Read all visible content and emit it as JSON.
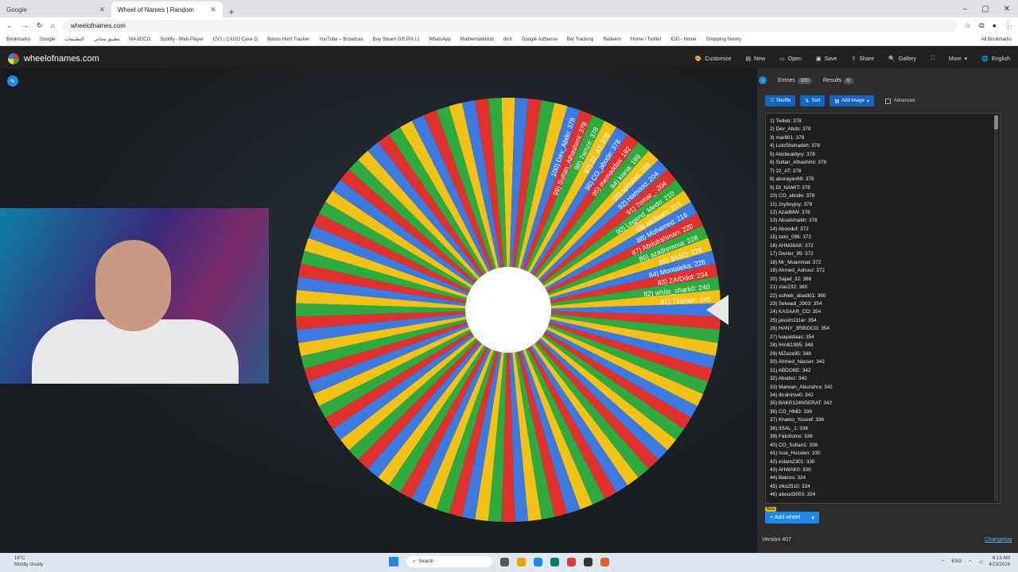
{
  "browser": {
    "tabs": [
      {
        "label": "Google",
        "active": false
      },
      {
        "label": "Wheel of Names | Random",
        "active": true
      }
    ],
    "new_tab": "+",
    "url": "wheelofnames.com",
    "bookmarks": [
      "Bookmarks",
      "Google",
      "التطبيقات",
      "تطبيق مجاني",
      "MAJIDCO",
      "Spotify - Web Player",
      "CV2 | CXGO Case O",
      "Bonus Hunt Tracker",
      "YouTube – Broadcas",
      "Buy Steam Gift PIX Lt",
      "WhatsApp",
      "Mathematikklub",
      "dich",
      "Google AdSense",
      "Bet Tracking",
      "Redeem",
      "Home / Twitter",
      "IOD - Home",
      "Shopping history"
    ],
    "all_bookmarks": "All Bookmarks"
  },
  "app": {
    "site_name": "wheelofnames.com",
    "menu": [
      "Customize",
      "New",
      "Open",
      "Save",
      "Share",
      "Gallery",
      "More",
      "English"
    ]
  },
  "panel": {
    "tab_entries": "Entries",
    "entries_count": "100",
    "tab_results": "Results",
    "results_count": "0",
    "shuffle": "Shuffle",
    "sort": "Sort",
    "add_image": "Add image",
    "advanced": "Advanced",
    "entries": [
      "1) Twileb: 378",
      "2) Dev_Abdo: 378",
      "3) mar801: 378",
      "4) LoloShehadeh: 378",
      "5) Abobealdyry: 378",
      "6) Sultan_Alhashimi: 378",
      "7) 22_AT: 378",
      "8) aburayan69: 378",
      "9) DI_NAMIT: 378",
      "10) CO_abode: 378",
      "11) Joyboyjoy: 378",
      "12) AzadMW: 378",
      "13) Abualshaikh: 378",
      "14) Abooduf: 372",
      "15) zero_096: 372",
      "16) AHM26AK: 372",
      "17) Dexter_95: 372",
      "18) Mr_Muammal: 372",
      "19) Ahmed_Ashour: 372",
      "20) Sajad_32: 366",
      "21) zias232: 360",
      "22) sohieb_abadi01: 360",
      "23) Selwadi_2003: 354",
      "24) KASAAR_CO: 354",
      "25) jassim111er: 354",
      "26) HANY_3RBIDCO: 354",
      "27) luayaldaas: 354",
      "28) IHAB1995: 348",
      "29) MZaza95: 348",
      "30) Ahmed_Nasser: 342",
      "31) ABDOBE: 342",
      "32) Abodez: 342",
      "33) Marwan_Abuzahra: 342",
      "34) Ibrahimw0: 342",
      "35) BAKR124NSERAT: 342",
      "36) CO_HMD: 336",
      "37) Khaloo_Yousef: 336",
      "38) 3SAL_1: 336",
      "39) Fato0omx: 336",
      "40) CO_Sultan1: 336",
      "41) Issa_Hussien: 330",
      "42) eslam2301: 330",
      "43) AHWAK0: 330",
      "44) Bakres: 324",
      "45) ziko2510: 324",
      "46) aboud3003: 324"
    ],
    "beta": "Beta",
    "add_wheel": "Add wheel",
    "version": "Version 407",
    "changelog": "Changelog"
  },
  "wheel": {
    "colors": [
      "#3d7ae0",
      "#e0312f",
      "#2faa3f",
      "#f2c218"
    ],
    "segment_count": 100,
    "visible_labels": [
      "81) 7asnain: 245",
      "82) white_shark0: 240",
      "83) ZAIDdol: 234",
      "84) Montaleka: 228",
      "85) 3ASQ: 228",
      "86) azadremma: 228",
      "87) Abdulrahman: 220",
      "88) Mohamed: 216",
      "89) aleflaam: 216",
      "90) Legend_Medo: 210",
      "91) 7omar_: 204",
      "92) Hamooo: 204",
      "93) spriolad: 198",
      "94) kiana: 198",
      "95) memaddas: 192",
      "96) CO_abode: 378",
      "97) 22_AT: 378",
      "98) 7amze: 378",
      "99) Sultan_Alhashimi: 378",
      "100) Dev_Abdo: 378"
    ]
  },
  "taskbar": {
    "weather_temp": "16°C",
    "weather_desc": "Mostly cloudy",
    "search": "Search",
    "lang": "ENG",
    "time": "6:13 AM",
    "date": "4/23/2024"
  }
}
